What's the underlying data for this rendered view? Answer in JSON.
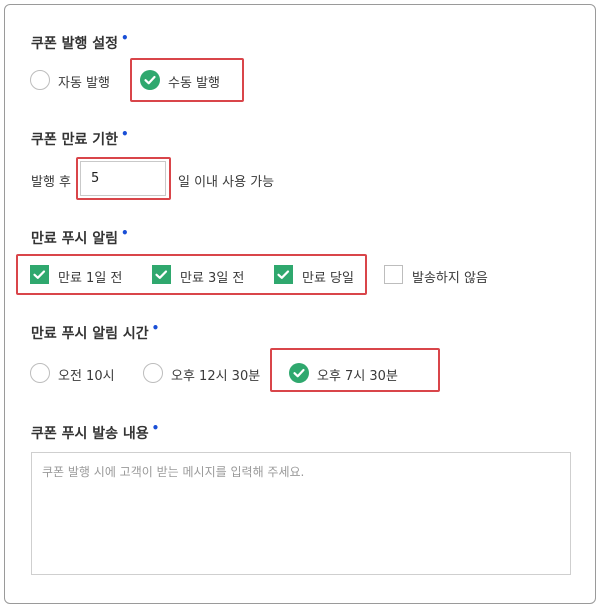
{
  "issue": {
    "title": "쿠폰 발행 설정",
    "options": [
      "자동 발행",
      "수동 발행"
    ]
  },
  "expiry": {
    "title": "쿠폰 만료 기한",
    "prefix": "발행 후",
    "value": "5",
    "suffix": "일 이내 사용 가능"
  },
  "push_alert": {
    "title": "만료 푸시 알림",
    "options": [
      "만료 1일 전",
      "만료 3일 전",
      "만료 당일",
      "발송하지 않음"
    ]
  },
  "push_time": {
    "title": "만료 푸시 알림 시간",
    "options": [
      "오전 10시",
      "오후 12시 30분",
      "오후 7시 30분"
    ]
  },
  "content": {
    "title": "쿠폰 푸시 발송 내용",
    "placeholder": "쿠폰 발행 시에 고객이 받는 메시지를 입력해 주세요."
  },
  "required_mark": "•",
  "colors": {
    "accent": "#2fa86e",
    "highlight": "#d9454a",
    "required": "#1a4fd6"
  }
}
